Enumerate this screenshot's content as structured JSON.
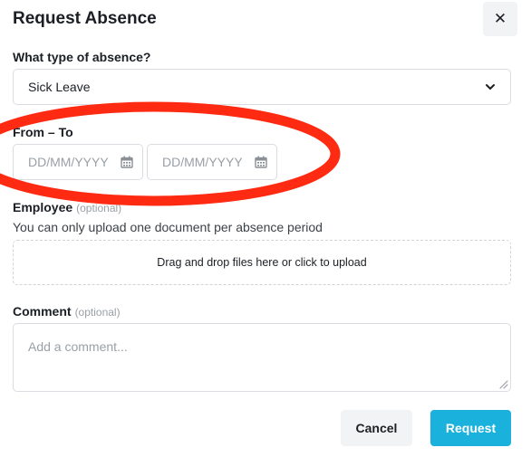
{
  "dialog": {
    "title": "Request Absence",
    "close_symbol": "✕"
  },
  "absence_type": {
    "label": "What type of absence?",
    "selected": "Sick Leave"
  },
  "date_range": {
    "label": "From – To",
    "from_placeholder": "DD/MM/YYYY",
    "to_placeholder": "DD/MM/YYYY"
  },
  "employee_doc": {
    "label": "Employee",
    "optional_tag": "(optional)",
    "helper": "You can only upload one document per absence period",
    "dropzone_text": "Drag and drop files here or click to upload"
  },
  "comment": {
    "label": "Comment",
    "optional_tag": "(optional)",
    "placeholder": "Add a comment..."
  },
  "actions": {
    "cancel_label": "Cancel",
    "request_label": "Request"
  },
  "colors": {
    "primary": "#1ab2dc",
    "annotation": "#ff2a12"
  },
  "icons": {
    "close": "close-icon",
    "chevron": "chevron-down-icon",
    "calendar": "calendar-icon",
    "resize": "resize-grip-icon"
  }
}
